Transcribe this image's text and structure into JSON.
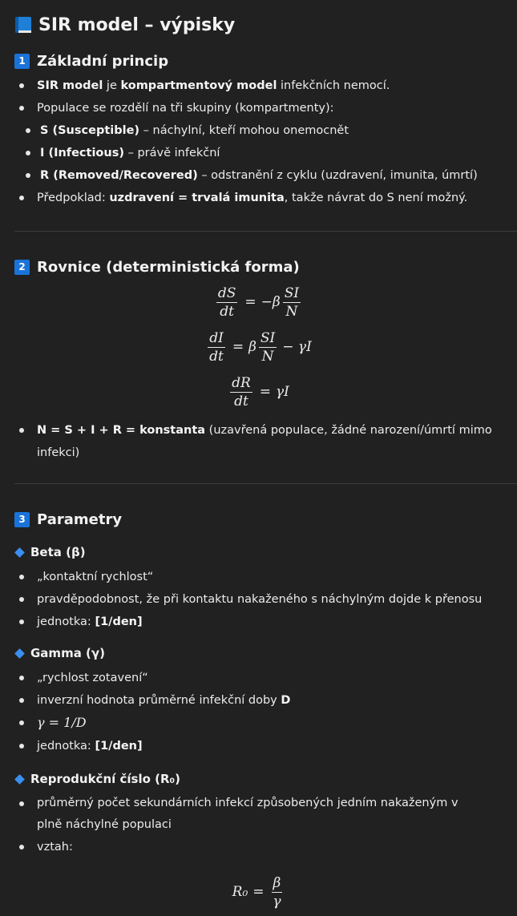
{
  "title": "SIR model – výpisky",
  "section1": {
    "num": "1",
    "heading": "Základní princip",
    "b1_bold1": "SIR model",
    "b1_t1": " je ",
    "b1_bold2": "kompartmentový model",
    "b1_t2": " infekčních nemocí.",
    "b2": "Populace se rozdělí na tři skupiny (kompartmenty):",
    "s_bold": "S (Susceptible)",
    "s_text": " – náchylní, kteří mohou onemocnět",
    "i_bold": "I (Infectious)",
    "i_text": " – právě infekční",
    "r_bold": "R (Removed/Recovered)",
    "r_text": " – odstranění z cyklu (uzdravení, imunita, úmrtí)",
    "b3_t1": "Předpoklad: ",
    "b3_bold1": "uzdravení = trvalá imunita",
    "b3_t2": ", takže návrat do S není možný."
  },
  "section2": {
    "num": "2",
    "heading": "Rovnice (deterministická forma)",
    "eq1": {
      "num": "dS",
      "den": "dt",
      "rhs_pre": "−β",
      "rhs_num": "SI",
      "rhs_den": "N"
    },
    "eq2": {
      "num": "dI",
      "den": "dt",
      "rhs_pre": "β",
      "rhs_num": "SI",
      "rhs_den": "N",
      "rhs_post": "− γI"
    },
    "eq3": {
      "num": "dR",
      "den": "dt",
      "rhs": "γI"
    },
    "eq_sign": "=",
    "b1_bold": "N = S + I + R = konstanta",
    "b1_text": " (uzavřená populace, žádné narození/úmrtí mimo infekci)"
  },
  "section3": {
    "num": "3",
    "heading": "Parametry",
    "beta": {
      "heading": "Beta (β)",
      "b1": "„kontaktní rychlost“",
      "b2": "pravděpodobnost, že při kontaktu nakaženého s náchylným dojde k přenosu",
      "b3_t": "jednotka: ",
      "b3_bold": "[1/den]"
    },
    "gamma": {
      "heading": "Gamma (γ)",
      "b1": "„rychlost zotavení“",
      "b2_t": "inverzní hodnota průměrné infekční doby ",
      "b2_bold": "D",
      "b3_math": "γ = 1/D",
      "b4_t": "jednotka: ",
      "b4_bold": "[1/den]"
    },
    "r0": {
      "heading": "Reprodukční číslo (R₀)",
      "b1": "průměrný počet sekundárních infekcí způsobených jedním nakaženým v plně náchylné populaci",
      "b2": "vztah:",
      "eq_lhs": "R₀",
      "eq_sign": "=",
      "eq_num": "β",
      "eq_den": "γ"
    }
  }
}
